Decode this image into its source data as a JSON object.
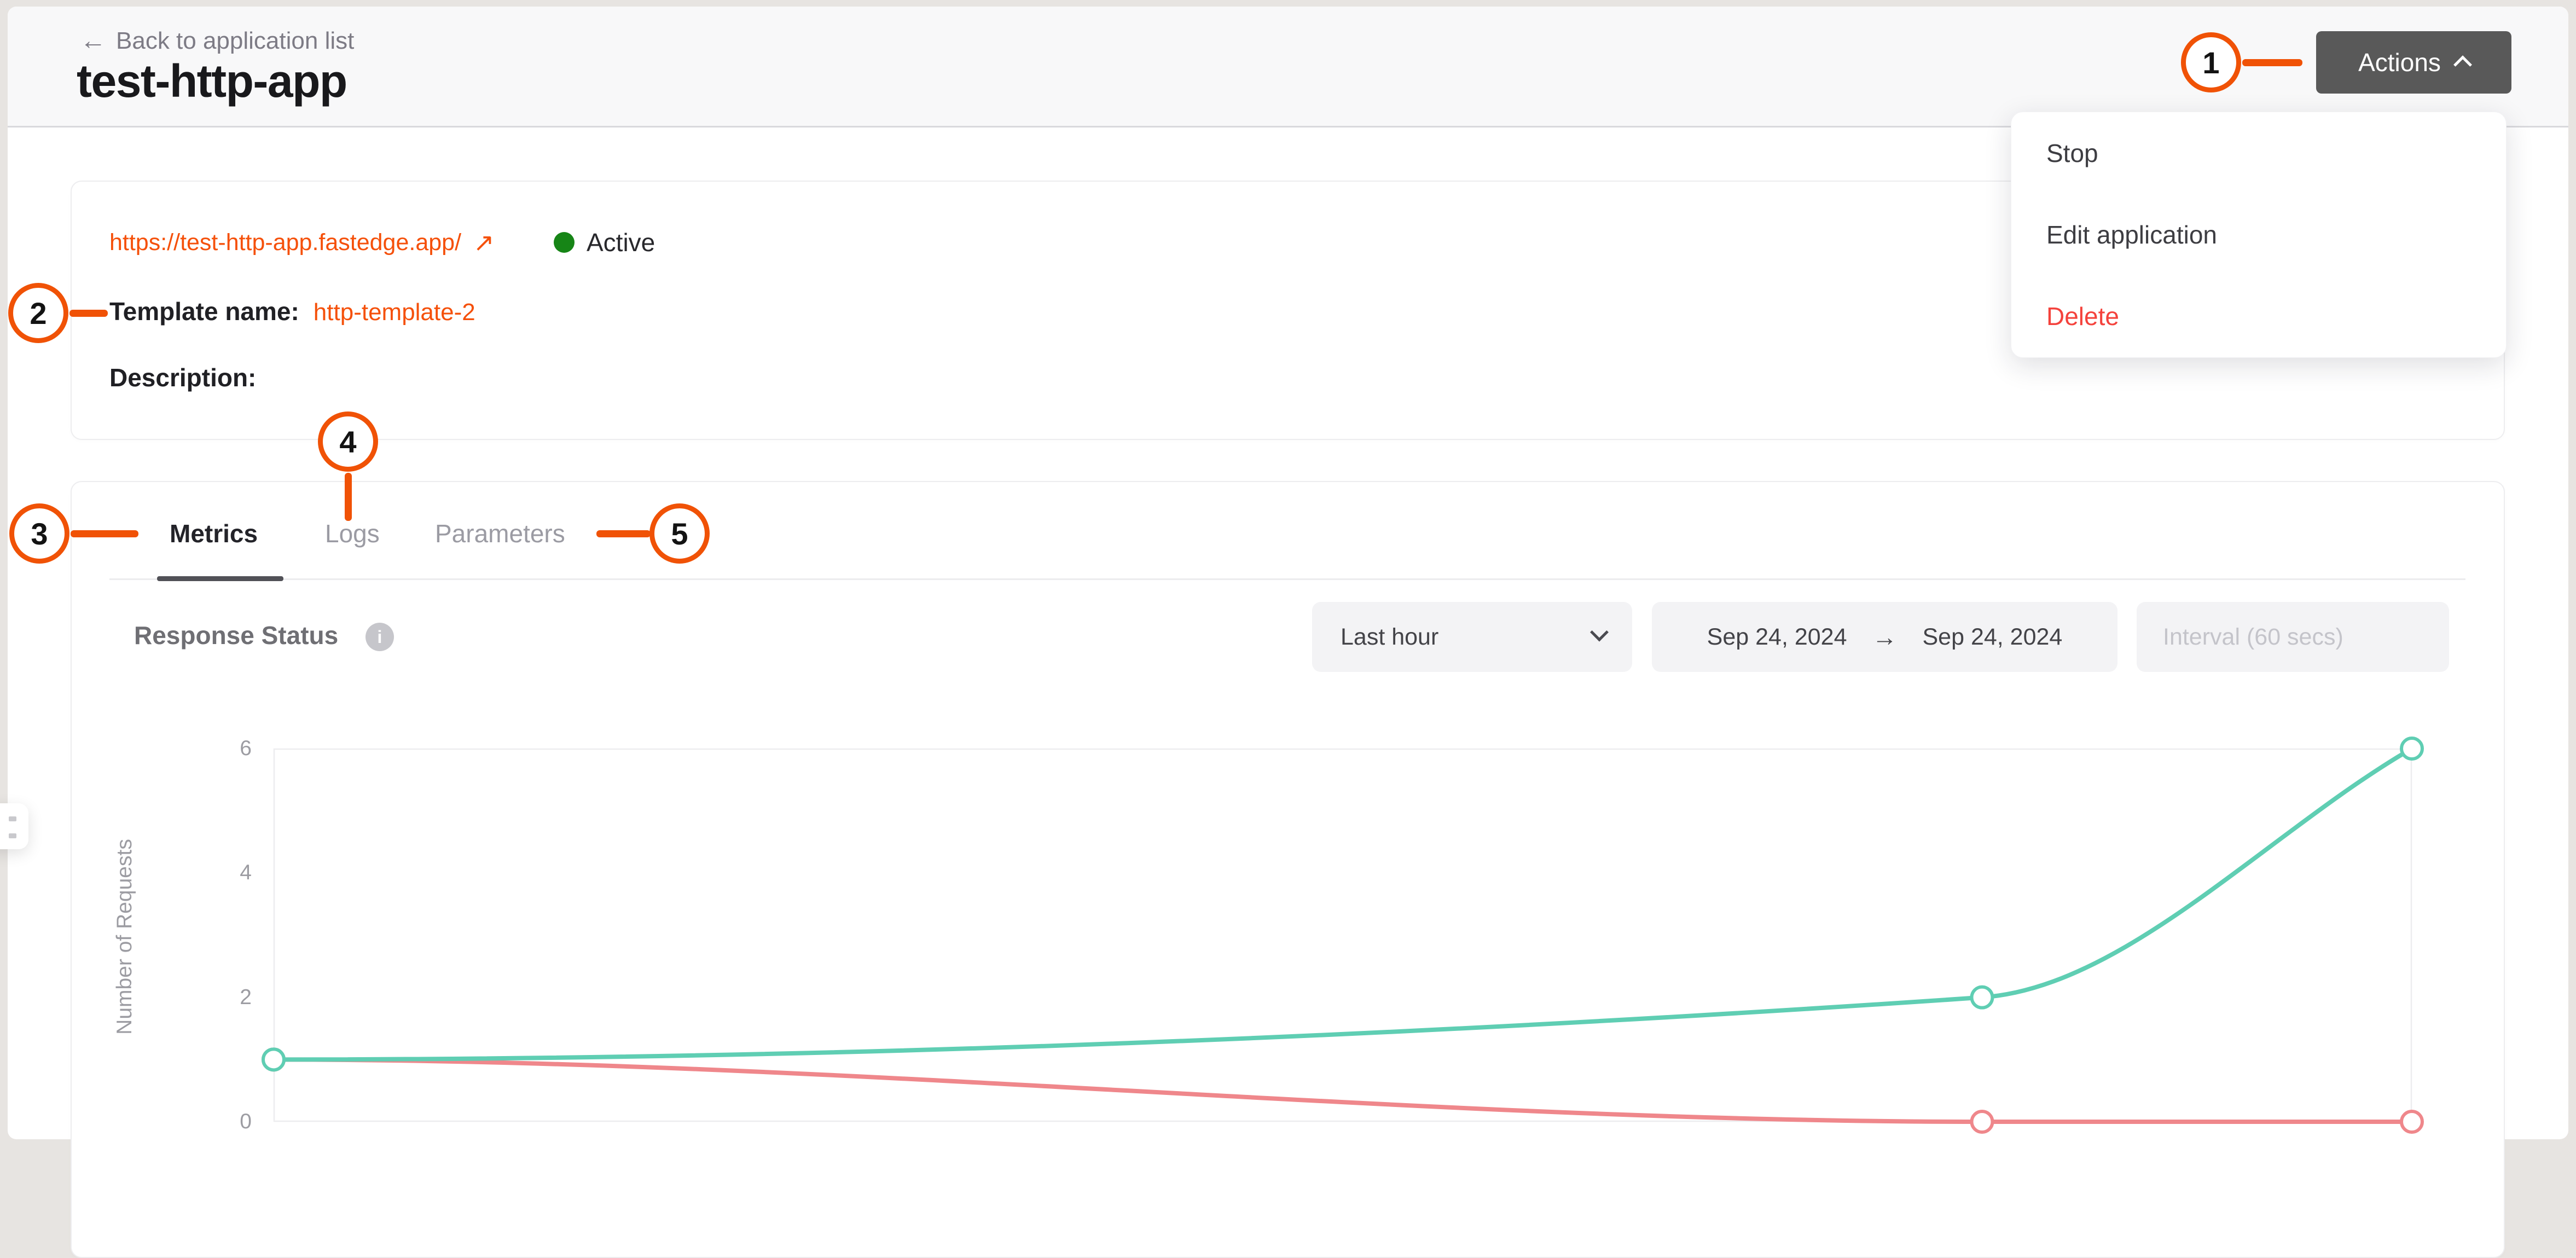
{
  "header": {
    "back_label": "Back to application list",
    "back_arrow": "←",
    "title": "test-http-app"
  },
  "actions": {
    "button_label": "Actions",
    "menu_items": [
      {
        "label": "Stop"
      },
      {
        "label": "Edit application"
      },
      {
        "label": "Delete"
      }
    ]
  },
  "app_info": {
    "url": "https://test-http-app.fastedge.app/",
    "external_arrow": "↗",
    "status": "Active",
    "template_label": "Template name:",
    "template_value": "http-template-2",
    "description_label": "Description:"
  },
  "tabs": [
    {
      "label": "Metrics"
    },
    {
      "label": "Logs"
    },
    {
      "label": "Parameters"
    }
  ],
  "metrics_controls": {
    "time_range": "Last hour",
    "date_from": "Sep 24, 2024",
    "date_arrow": "→",
    "date_to": "Sep 24, 2024",
    "interval": "Interval (60 secs)",
    "info_icon_glyph": "i"
  },
  "callouts": {
    "c1": "1",
    "c2": "2",
    "c3": "3",
    "c4": "4",
    "c5": "5"
  },
  "colors": {
    "accent_link": "#f5500a",
    "callout_orange": "#f05206",
    "status_green": "#168516",
    "danger_red": "#f4423c",
    "actions_button_gray": "#595959"
  },
  "chart_data": {
    "type": "line",
    "title": "Response Status",
    "ylabel": "Number of Requests",
    "xlabel": "",
    "ylim": [
      0,
      6
    ],
    "yticks": [
      6,
      4,
      2,
      0
    ],
    "grid": "plot border box only, no inner gridlines",
    "legend_position": "none",
    "smooth": true,
    "marker": "hollow-circle",
    "series": [
      {
        "name": "series-teal",
        "color": "#5fceb3",
        "x_fractions": [
          0,
          0.799,
          1
        ],
        "values": [
          1,
          2,
          6
        ]
      },
      {
        "name": "series-red",
        "color": "#ef878b",
        "x_fractions": [
          0,
          0.799,
          1
        ],
        "values": [
          1,
          0,
          0
        ]
      }
    ]
  }
}
